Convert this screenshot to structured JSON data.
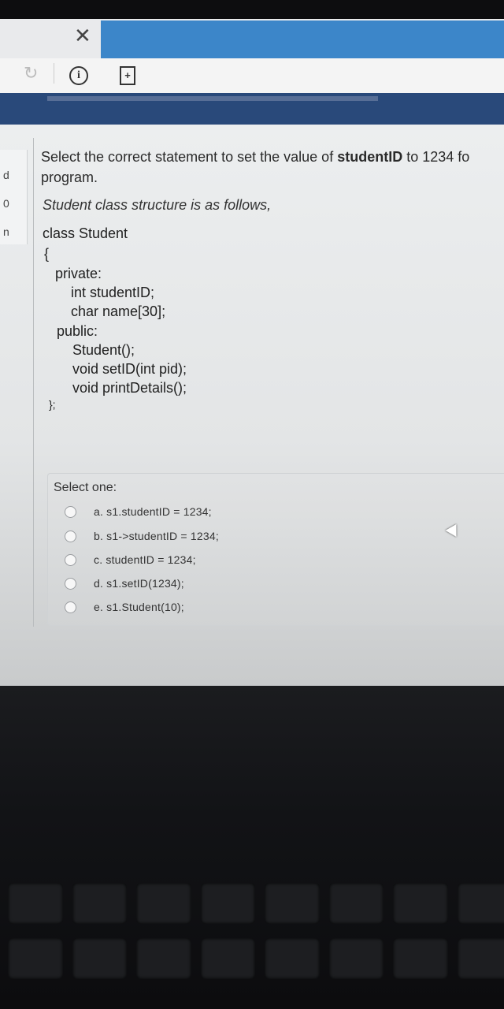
{
  "browser": {
    "close_glyph": "✕",
    "reload_glyph": "↻",
    "info_glyph": "i",
    "newdoc_glyph": "+"
  },
  "sidebar": {
    "fragments": [
      "d",
      "0",
      "n"
    ]
  },
  "question": {
    "text_before": "Select the correct statement to set the value of ",
    "bold_term": "studentID",
    "text_after": " to 1234 fo",
    "line2": "program.",
    "intro": "Student class structure is as follows,"
  },
  "code": {
    "lines": [
      "class Student",
      "{",
      "private:",
      "int studentID;",
      "char name[30];",
      "public:",
      "Student();",
      "void setID(int pid);",
      "void printDetails();",
      "};"
    ]
  },
  "quiz": {
    "select_label": "Select one:",
    "options": [
      "a. s1.studentID = 1234;",
      "b. s1->studentID = 1234;",
      "c. studentID = 1234;",
      "d. s1.setID(1234);",
      "e. s1.Student(10);"
    ]
  }
}
